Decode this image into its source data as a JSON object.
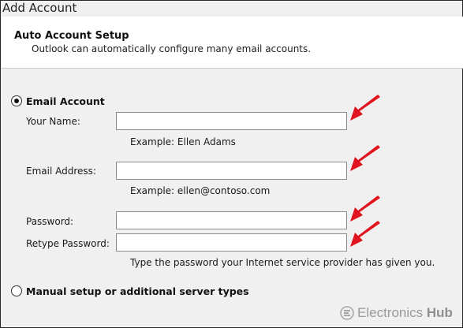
{
  "window": {
    "title": "Add Account"
  },
  "header": {
    "title": "Auto Account Setup",
    "subtitle": "Outlook can automatically configure many email accounts."
  },
  "options": {
    "email_account": {
      "label": "Email Account",
      "selected": true
    },
    "manual_setup": {
      "label": "Manual setup or additional server types",
      "selected": false
    }
  },
  "fields": {
    "name": {
      "label": "Your Name:",
      "value": "",
      "hint": "Example: Ellen Adams"
    },
    "email": {
      "label": "Email Address:",
      "value": "",
      "hint": "Example: ellen@contoso.com"
    },
    "password": {
      "label": "Password:",
      "value": ""
    },
    "retype": {
      "label": "Retype Password:",
      "value": ""
    },
    "password_hint": "Type the password your Internet service provider has given you."
  },
  "watermark": {
    "brand_main": "Electronics",
    "brand_bold": "Hub",
    "icon": "electronicshub-logo-icon"
  },
  "annotation": {
    "arrow_color": "#e0141e",
    "icon": "red-arrow-icon"
  }
}
